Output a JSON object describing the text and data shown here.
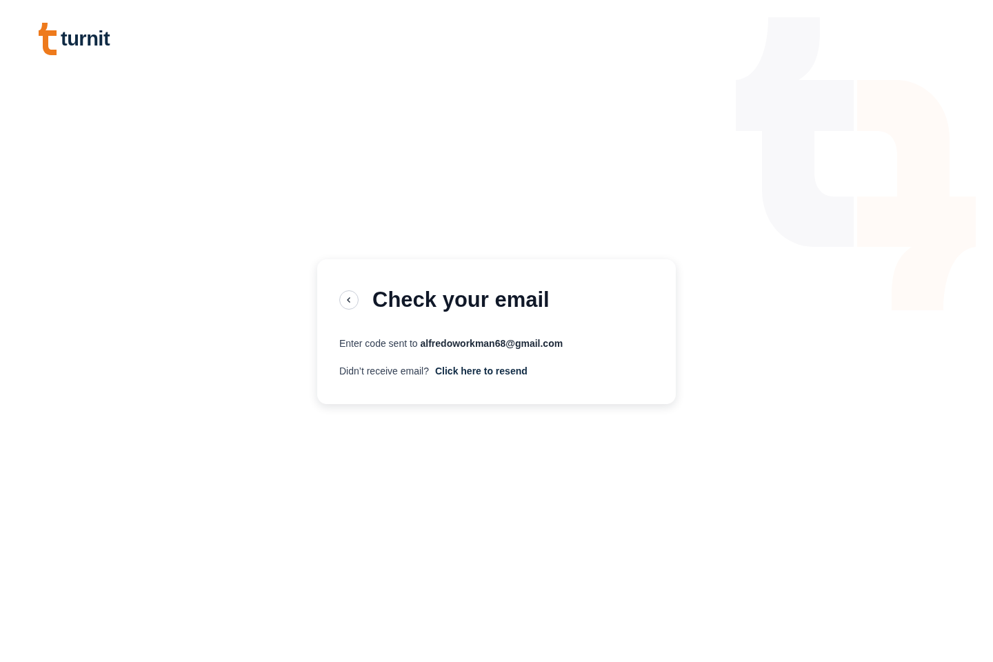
{
  "logo": {
    "text": "turnit"
  },
  "card": {
    "title": "Check your email",
    "message": "Enter code sent to **alfredoworkman68@gmail.com**",
    "resend_prompt": "Didn’t receive email?",
    "resend_link": "Click here to resend"
  }
}
